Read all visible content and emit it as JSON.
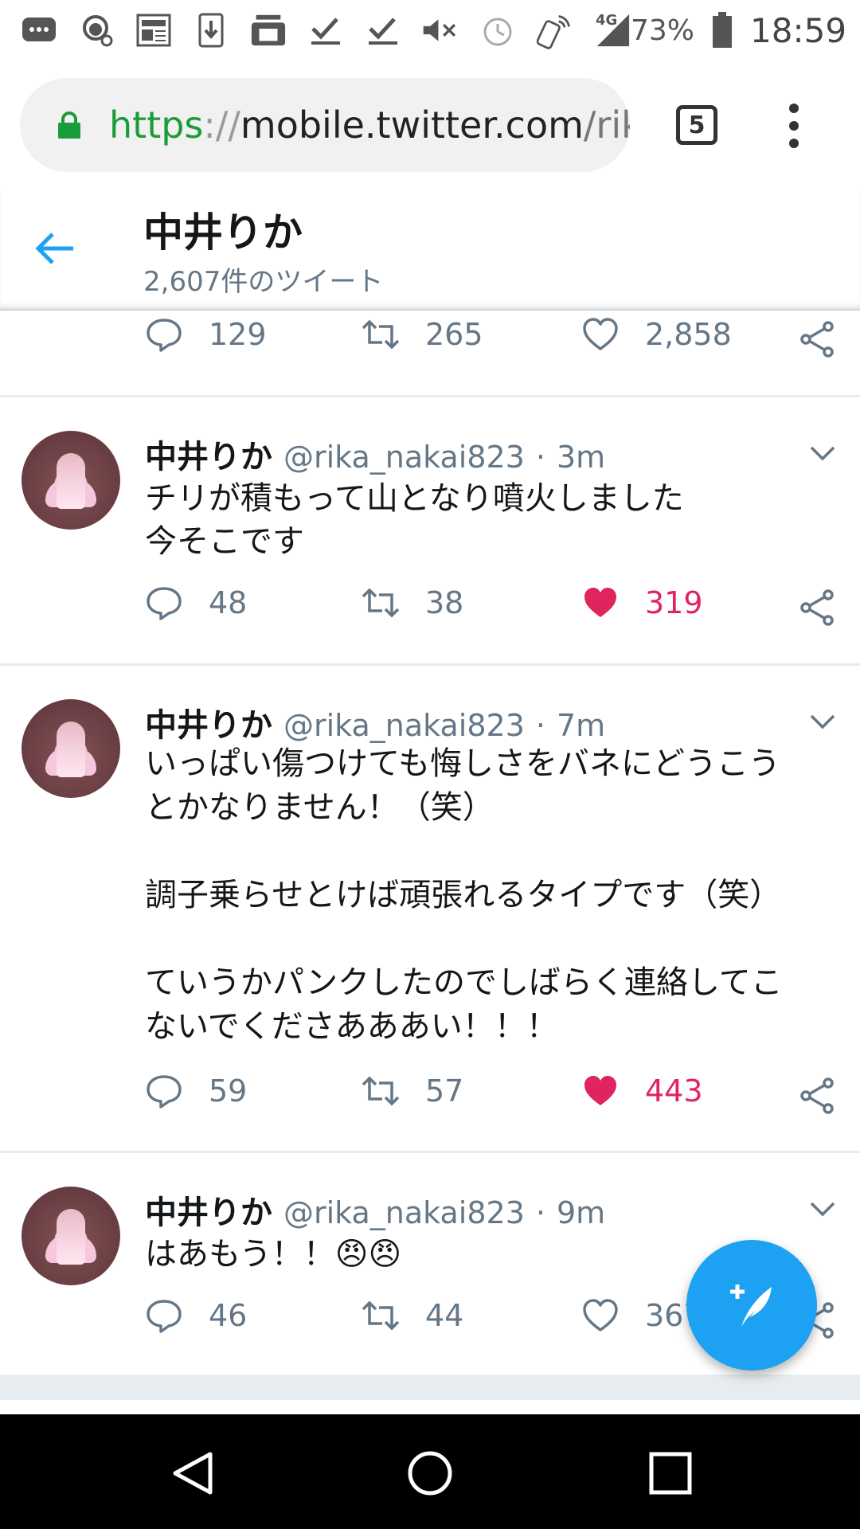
{
  "status_bar": {
    "icons": [
      "chat-icon",
      "headset-icon",
      "newspaper-icon",
      "download-icon",
      "liq-mobile-icon",
      "check-icon",
      "check-icon",
      "mute-icon",
      "alarm-icon",
      "wifi-call-icon",
      "signal-4g-icon"
    ],
    "network": "4G",
    "battery": "73%",
    "time": "18:59"
  },
  "browser": {
    "url_scheme": "https",
    "url_separator": "://",
    "url_host": "mobile.twitter.com",
    "url_path": "/rik",
    "tab_count": "5"
  },
  "profile_header": {
    "name": "中井りか",
    "tweet_count": "2,607件のツイート"
  },
  "top_actions": {
    "replies": "129",
    "retweets": "265",
    "likes": "2,858"
  },
  "tweets": [
    {
      "name": "中井りか",
      "handle": "@rika_nakai823",
      "dot": "·",
      "time": "3m",
      "text": "チリが積もって山となり噴火しました\n今そこです",
      "replies": "48",
      "retweets": "38",
      "likes": "319",
      "liked": true
    },
    {
      "name": "中井りか",
      "handle": "@rika_nakai823",
      "dot": "·",
      "time": "7m",
      "text": "いっぱい傷つけても悔しさをバネにどうこう\nとかなりません！（笑）\n\n調子乗らせとけば頑張れるタイプです（笑）\n\nていうかパンクしたのでしばらく連絡してこ\nないでくださあああい！！！",
      "replies": "59",
      "retweets": "57",
      "likes": "443",
      "liked": true
    },
    {
      "name": "中井りか",
      "handle": "@rika_nakai823",
      "dot": "·",
      "time": "9m",
      "text": "はあもう！！😠😠",
      "replies": "46",
      "retweets": "44",
      "likes": "367",
      "liked": false
    }
  ],
  "colors": {
    "accent": "#1da1f2",
    "like": "#e0245e",
    "muted": "#657786",
    "secure": "#1a9c3a"
  }
}
